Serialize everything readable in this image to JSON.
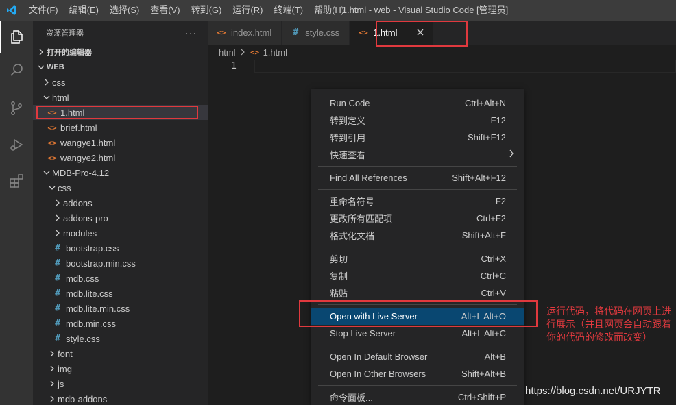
{
  "titlebar": {
    "menus": [
      "文件(F)",
      "编辑(E)",
      "选择(S)",
      "查看(V)",
      "转到(G)",
      "运行(R)",
      "终端(T)",
      "帮助(H)"
    ],
    "title": "1.html - web - Visual Studio Code [管理员]"
  },
  "activitybar": {
    "icons": [
      "explorer-icon",
      "search-icon",
      "source-control-icon",
      "run-debug-icon",
      "extensions-icon"
    ]
  },
  "sidebar": {
    "header": "资源管理器",
    "more": "···",
    "open_editors": "打开的编辑器",
    "workspace": "WEB",
    "tree": [
      {
        "label": "css",
        "type": "folder",
        "depth": 1,
        "open": false
      },
      {
        "label": "html",
        "type": "folder",
        "depth": 1,
        "open": true
      },
      {
        "label": "1.html",
        "type": "html",
        "depth": 2,
        "selected": true
      },
      {
        "label": "brief.html",
        "type": "html",
        "depth": 2
      },
      {
        "label": "wangye1.html",
        "type": "html",
        "depth": 2
      },
      {
        "label": "wangye2.html",
        "type": "html",
        "depth": 2
      },
      {
        "label": "MDB-Pro-4.12",
        "type": "folder",
        "depth": 1,
        "open": true
      },
      {
        "label": "css",
        "type": "folder",
        "depth": 2,
        "open": true
      },
      {
        "label": "addons",
        "type": "folder",
        "depth": 3,
        "open": false
      },
      {
        "label": "addons-pro",
        "type": "folder",
        "depth": 3,
        "open": false
      },
      {
        "label": "modules",
        "type": "folder",
        "depth": 3,
        "open": false
      },
      {
        "label": "bootstrap.css",
        "type": "css",
        "depth": 3
      },
      {
        "label": "bootstrap.min.css",
        "type": "css",
        "depth": 3
      },
      {
        "label": "mdb.css",
        "type": "css",
        "depth": 3
      },
      {
        "label": "mdb.lite.css",
        "type": "css",
        "depth": 3
      },
      {
        "label": "mdb.lite.min.css",
        "type": "css",
        "depth": 3
      },
      {
        "label": "mdb.min.css",
        "type": "css",
        "depth": 3
      },
      {
        "label": "style.css",
        "type": "css",
        "depth": 3
      },
      {
        "label": "font",
        "type": "folder",
        "depth": 2,
        "open": false
      },
      {
        "label": "img",
        "type": "folder",
        "depth": 2,
        "open": false
      },
      {
        "label": "js",
        "type": "folder",
        "depth": 2,
        "open": false
      },
      {
        "label": "mdb-addons",
        "type": "folder",
        "depth": 2,
        "open": false
      }
    ]
  },
  "editor": {
    "tabs": [
      {
        "label": "index.html",
        "icon": "html",
        "active": false
      },
      {
        "label": "style.css",
        "icon": "css",
        "active": false
      },
      {
        "label": "1.html",
        "icon": "html",
        "active": true
      }
    ],
    "breadcrumb": [
      "html",
      "1.html"
    ],
    "line_number": "1"
  },
  "context_menu": {
    "groups": [
      [
        {
          "label": "Run Code",
          "shortcut": "Ctrl+Alt+N"
        },
        {
          "label": "转到定义",
          "shortcut": "F12"
        },
        {
          "label": "转到引用",
          "shortcut": "Shift+F12"
        },
        {
          "label": "快速查看",
          "shortcut": "",
          "submenu": true
        }
      ],
      [
        {
          "label": "Find All References",
          "shortcut": "Shift+Alt+F12"
        }
      ],
      [
        {
          "label": "重命名符号",
          "shortcut": "F2"
        },
        {
          "label": "更改所有匹配项",
          "shortcut": "Ctrl+F2"
        },
        {
          "label": "格式化文档",
          "shortcut": "Shift+Alt+F"
        }
      ],
      [
        {
          "label": "剪切",
          "shortcut": "Ctrl+X"
        },
        {
          "label": "复制",
          "shortcut": "Ctrl+C"
        },
        {
          "label": "粘贴",
          "shortcut": "Ctrl+V"
        }
      ],
      [
        {
          "label": "Open with Live Server",
          "shortcut": "Alt+L Alt+O",
          "highlighted": true
        },
        {
          "label": "Stop Live Server",
          "shortcut": "Alt+L Alt+C"
        }
      ],
      [
        {
          "label": "Open In Default Browser",
          "shortcut": "Alt+B"
        },
        {
          "label": "Open In Other Browsers",
          "shortcut": "Shift+Alt+B"
        }
      ],
      [
        {
          "label": "命令面板...",
          "shortcut": "Ctrl+Shift+P"
        }
      ]
    ]
  },
  "annotation": "运行代码，将代码在网页上进行展示（并且网页会自动跟着你的代码的修改而改变）",
  "watermark": "https://blog.csdn.net/URJYTR",
  "colors": {
    "accent_red": "#e0393e",
    "html_icon": "#e37933",
    "css_icon": "#519aba",
    "menu_highlight": "#094771"
  }
}
